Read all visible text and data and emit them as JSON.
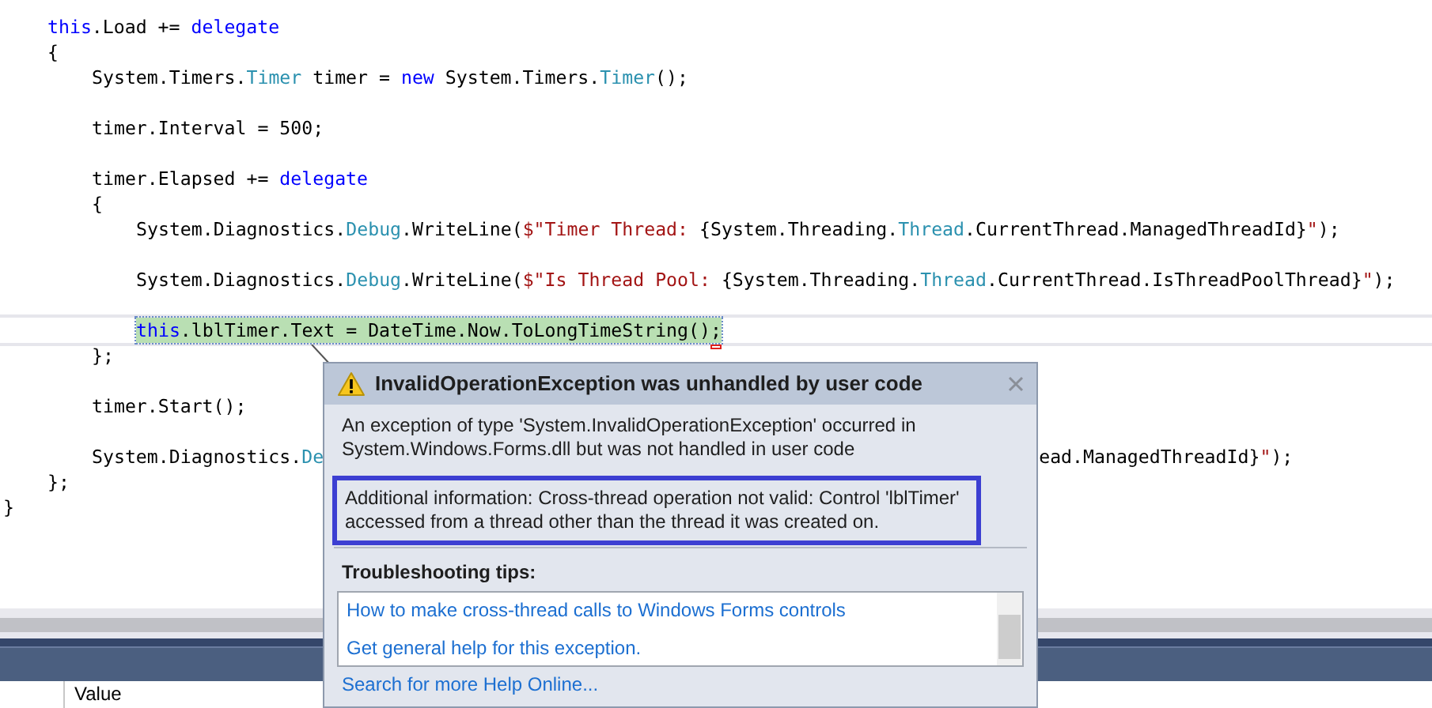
{
  "editor": {
    "lines": [
      {
        "children": [
          {
            "tokens": [
              {
                "kind": "keyword",
                "text": "this"
              },
              {
                "kind": "plain",
                "text": ".Load += "
              },
              {
                "kind": "keyword",
                "text": "delegate"
              }
            ]
          },
          {
            "tokens": [
              {
                "kind": "plain",
                "text": "{"
              }
            ]
          },
          {
            "children": [
              {
                "tokens": [
                  {
                    "kind": "plain",
                    "text": "System.Timers."
                  },
                  {
                    "kind": "type",
                    "text": "Timer"
                  },
                  {
                    "kind": "plain",
                    "text": " timer = "
                  },
                  {
                    "kind": "keyword",
                    "text": "new"
                  },
                  {
                    "kind": "plain",
                    "text": " System.Timers."
                  },
                  {
                    "kind": "type",
                    "text": "Timer"
                  },
                  {
                    "kind": "plain",
                    "text": "();"
                  }
                ]
              },
              {
                "kind": "blank"
              },
              {
                "tokens": [
                  {
                    "kind": "plain",
                    "text": "timer.Interval = 500;"
                  }
                ]
              },
              {
                "kind": "blank"
              },
              {
                "tokens": [
                  {
                    "kind": "plain",
                    "text": "timer.Elapsed += "
                  },
                  {
                    "kind": "keyword",
                    "text": "delegate"
                  }
                ]
              },
              {
                "tokens": [
                  {
                    "kind": "plain",
                    "text": "{"
                  }
                ]
              },
              {
                "children": [
                  {
                    "tokens": [
                      {
                        "kind": "plain",
                        "text": "System.Diagnostics."
                      },
                      {
                        "kind": "type",
                        "text": "Debug"
                      },
                      {
                        "kind": "plain",
                        "text": ".WriteLine("
                      },
                      {
                        "kind": "string",
                        "text": "$\"Timer Thread: "
                      },
                      {
                        "kind": "plain",
                        "text": "{System.Threading."
                      },
                      {
                        "kind": "type",
                        "text": "Thread"
                      },
                      {
                        "kind": "plain",
                        "text": ".CurrentThread.ManagedThreadId}"
                      },
                      {
                        "kind": "string",
                        "text": "\""
                      },
                      {
                        "kind": "plain",
                        "text": ");"
                      }
                    ]
                  },
                  {
                    "kind": "blank"
                  },
                  {
                    "tokens": [
                      {
                        "kind": "plain",
                        "text": "System.Diagnostics."
                      },
                      {
                        "kind": "type",
                        "text": "Debug"
                      },
                      {
                        "kind": "plain",
                        "text": ".WriteLine("
                      },
                      {
                        "kind": "string",
                        "text": "$\"Is Thread Pool: "
                      },
                      {
                        "kind": "plain",
                        "text": "{System.Threading."
                      },
                      {
                        "kind": "type",
                        "text": "Thread"
                      },
                      {
                        "kind": "plain",
                        "text": ".CurrentThread.IsThreadPoolThread}"
                      },
                      {
                        "kind": "string",
                        "text": "\""
                      },
                      {
                        "kind": "plain",
                        "text": ");"
                      }
                    ]
                  },
                  {
                    "kind": "blank"
                  },
                  {
                    "current": true,
                    "highlighted": true,
                    "error_mark": true,
                    "tokens": [
                      {
                        "kind": "keyword",
                        "text": "this"
                      },
                      {
                        "kind": "plain",
                        "text": ".lblTimer.Text = DateTime.Now.ToLongTimeString();"
                      }
                    ]
                  }
                ]
              },
              {
                "tokens": [
                  {
                    "kind": "plain",
                    "text": "};"
                  }
                ]
              },
              {
                "kind": "blank"
              },
              {
                "tokens": [
                  {
                    "kind": "plain",
                    "text": "timer.Start();"
                  }
                ]
              },
              {
                "kind": "blank"
              },
              {
                "tokens": [
                  {
                    "kind": "plain",
                    "text": "System.Diagnostics."
                  },
                  {
                    "kind": "type",
                    "text": "De"
                  }
                ],
                "tail": [
                  {
                    "kind": "plain",
                    "text": "ead.ManagedThreadId}"
                  },
                  {
                    "kind": "string",
                    "text": "\""
                  },
                  {
                    "kind": "plain",
                    "text": ");"
                  }
                ]
              }
            ]
          },
          {
            "tokens": [
              {
                "kind": "plain",
                "text": "};"
              }
            ]
          }
        ]
      },
      {
        "tokens": [
          {
            "kind": "plain",
            "text": "}"
          }
        ]
      }
    ]
  },
  "exception_dialog": {
    "title": "InvalidOperationException was unhandled by user code",
    "message": "An exception of type 'System.InvalidOperationException' occurred in System.Windows.Forms.dll but was not handled in user code",
    "additional_info": "Additional information: Cross-thread operation not valid: Control 'lblTimer' accessed from a thread other than the thread it was created on.",
    "tips_heading": "Troubleshooting tips:",
    "tips": [
      "How to make cross-thread calls to Windows Forms controls",
      "Get general help for this exception."
    ],
    "footer_link": "Search for more Help Online..."
  },
  "bottom_panel": {
    "column_2": "Value"
  }
}
